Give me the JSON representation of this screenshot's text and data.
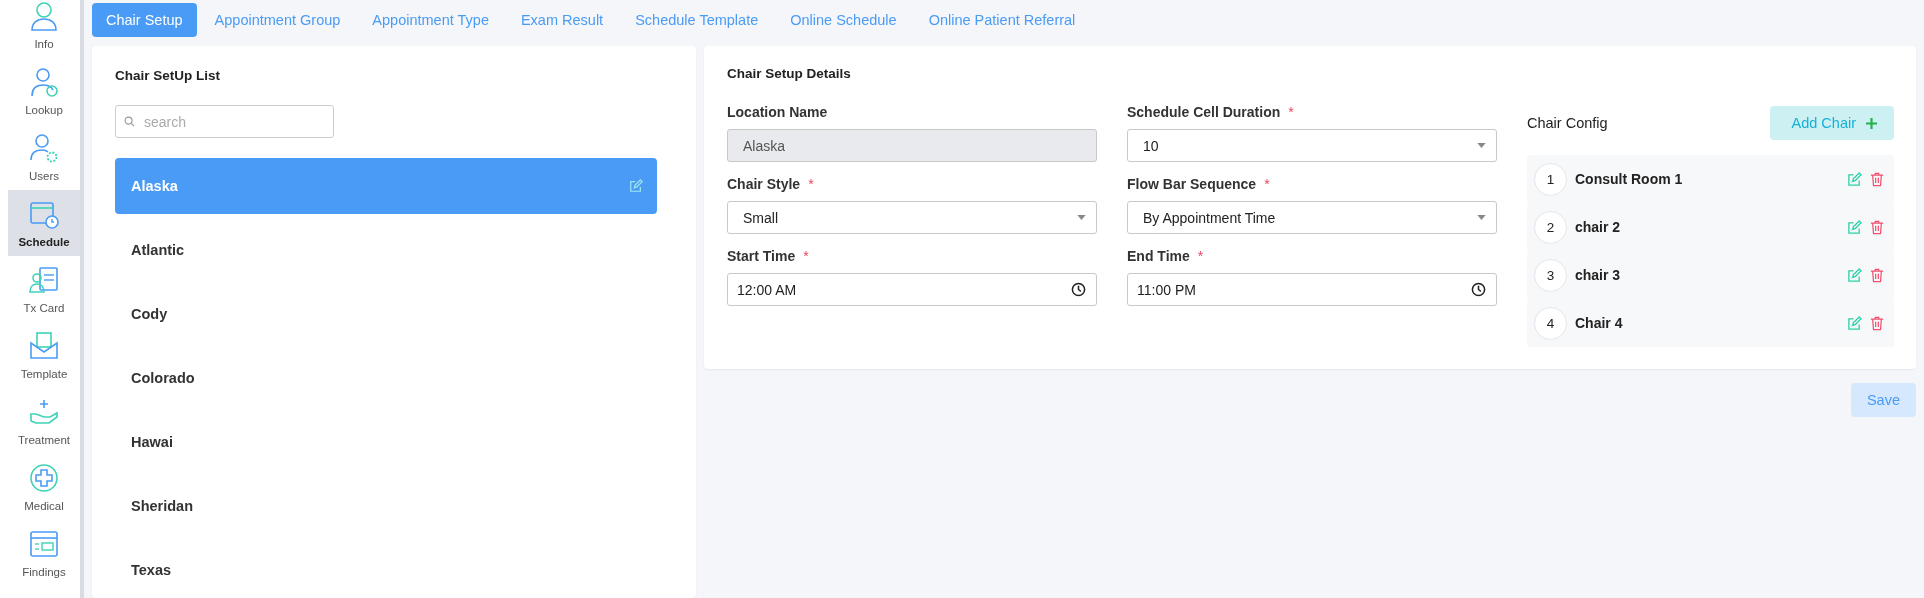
{
  "sidebar": {
    "items": [
      {
        "label": "Info",
        "selected": false
      },
      {
        "label": "Lookup",
        "selected": false
      },
      {
        "label": "Users",
        "selected": false
      },
      {
        "label": "Schedule",
        "selected": true
      },
      {
        "label": "Tx Card",
        "selected": false
      },
      {
        "label": "Template",
        "selected": false
      },
      {
        "label": "Treatment",
        "selected": false
      },
      {
        "label": "Medical",
        "selected": false
      },
      {
        "label": "Findings",
        "selected": false
      }
    ]
  },
  "tabs": [
    {
      "label": "Chair Setup",
      "selected": true
    },
    {
      "label": "Appointment Group",
      "selected": false
    },
    {
      "label": "Appointment Type",
      "selected": false
    },
    {
      "label": "Exam Result",
      "selected": false
    },
    {
      "label": "Schedule Template",
      "selected": false
    },
    {
      "label": "Online Schedule",
      "selected": false
    },
    {
      "label": "Online Patient Referral",
      "selected": false
    }
  ],
  "location_list": {
    "title": "Chair SetUp List",
    "search": {
      "placeholder": "search"
    },
    "items": [
      {
        "name": "Alaska",
        "selected": true
      },
      {
        "name": "Atlantic",
        "selected": false
      },
      {
        "name": "Cody",
        "selected": false
      },
      {
        "name": "Colorado",
        "selected": false
      },
      {
        "name": "Hawai",
        "selected": false
      },
      {
        "name": "Sheridan",
        "selected": false
      },
      {
        "name": "Texas",
        "selected": false
      }
    ]
  },
  "details": {
    "title": "Chair Setup Details",
    "fields": [
      {
        "label": "Location Name",
        "kind": "readonly",
        "value": "Alaska"
      },
      {
        "label": "Schedule Cell Duration",
        "required_mark": "*",
        "kind": "select",
        "value": "10"
      },
      {
        "label": "Chair Style",
        "required_mark": "*",
        "kind": "select",
        "value": "Small"
      },
      {
        "label": "Flow Bar Sequence",
        "required_mark": "*",
        "kind": "select",
        "value": "By Appointment Time"
      },
      {
        "label": "Start Time",
        "required_mark": "*",
        "kind": "time",
        "value": "12:00 AM"
      },
      {
        "label": "End Time",
        "required_mark": "*",
        "kind": "time",
        "value": "11:00 PM"
      }
    ]
  },
  "chair_config": {
    "title": "Chair Config",
    "add_button": "Add Chair",
    "chairs": [
      {
        "number": "1",
        "name": "Consult Room 1"
      },
      {
        "number": "2",
        "name": "chair 2"
      },
      {
        "number": "3",
        "name": "chair 3"
      },
      {
        "number": "4",
        "name": "Chair 4"
      }
    ]
  },
  "save_button": "Save"
}
